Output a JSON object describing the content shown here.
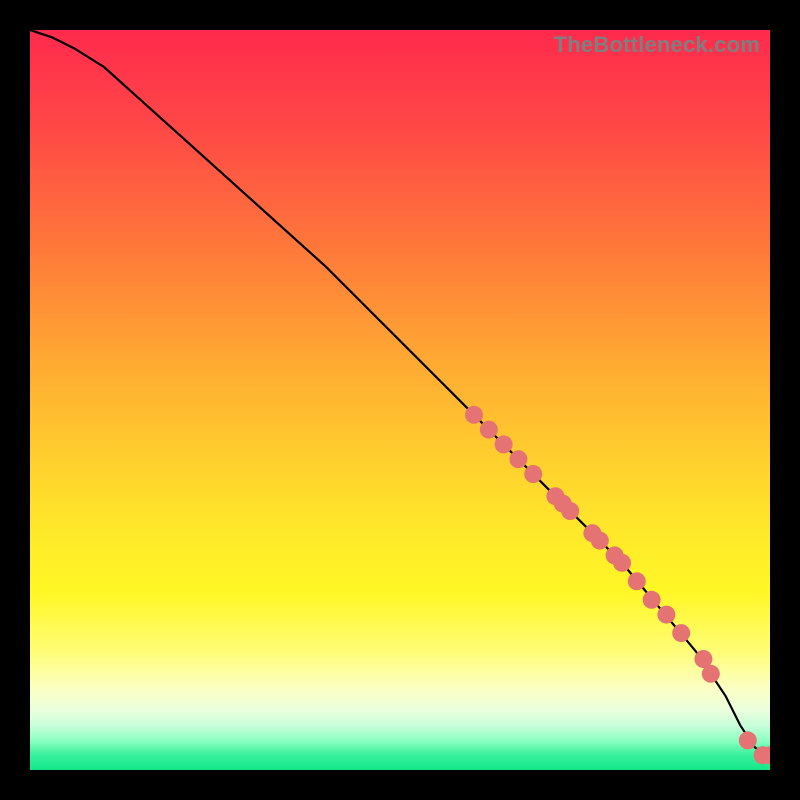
{
  "attribution": "TheBottleneck.com",
  "colors": {
    "marker": "#e57373",
    "marker_stroke": "#b85a5a",
    "curve": "#000000"
  },
  "chart_data": {
    "type": "line",
    "title": "",
    "xlabel": "",
    "ylabel": "",
    "xlim": [
      0,
      100
    ],
    "ylim": [
      0,
      100
    ],
    "grid": false,
    "series": [
      {
        "name": "curve",
        "x": [
          0,
          3,
          6,
          10,
          20,
          30,
          40,
          50,
          60,
          70,
          80,
          90,
          94,
          96,
          98,
          100
        ],
        "y": [
          100,
          99,
          97.5,
          95,
          86,
          77,
          68,
          58,
          48,
          38,
          28,
          16,
          10,
          6,
          3,
          2
        ]
      }
    ],
    "markers": [
      {
        "x": 60,
        "y": 48
      },
      {
        "x": 62,
        "y": 46
      },
      {
        "x": 64,
        "y": 44
      },
      {
        "x": 66,
        "y": 42
      },
      {
        "x": 68,
        "y": 40
      },
      {
        "x": 71,
        "y": 37
      },
      {
        "x": 72,
        "y": 36
      },
      {
        "x": 73,
        "y": 35
      },
      {
        "x": 76,
        "y": 32
      },
      {
        "x": 77,
        "y": 31
      },
      {
        "x": 79,
        "y": 29
      },
      {
        "x": 80,
        "y": 28
      },
      {
        "x": 82,
        "y": 25.5
      },
      {
        "x": 84,
        "y": 23
      },
      {
        "x": 86,
        "y": 21
      },
      {
        "x": 88,
        "y": 18.5
      },
      {
        "x": 91,
        "y": 15
      },
      {
        "x": 92,
        "y": 13
      },
      {
        "x": 97,
        "y": 4
      },
      {
        "x": 99,
        "y": 2
      },
      {
        "x": 100,
        "y": 2
      }
    ]
  }
}
